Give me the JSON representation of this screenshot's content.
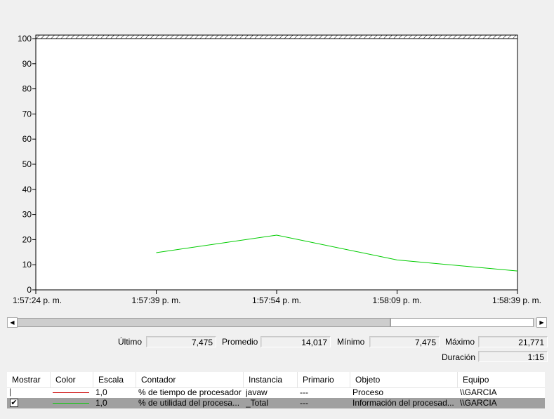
{
  "chart_data": {
    "type": "line",
    "ylim": [
      0,
      100
    ],
    "y_ticks": [
      "0",
      "10",
      "20",
      "30",
      "40",
      "50",
      "60",
      "70",
      "80",
      "90",
      "100"
    ],
    "x_ticks": [
      "1:57:24 p. m.",
      "1:57:39 p. m.",
      "1:57:54 p. m.",
      "1:58:09 p. m.",
      "1:58:39 p. m."
    ],
    "grid": false,
    "series": [
      {
        "color": "#00cc00",
        "points": [
          {
            "x": 1.0,
            "y": 14.8
          },
          {
            "x": 2.0,
            "y": 21.8
          },
          {
            "x": 3.0,
            "y": 11.9
          },
          {
            "x": 4.0,
            "y": 7.5
          }
        ]
      }
    ]
  },
  "stats": {
    "last_label": "Último",
    "last_value": "7,475",
    "avg_label": "Promedio",
    "avg_value": "14,017",
    "min_label": "Mínimo",
    "min_value": "7,475",
    "max_label": "Máximo",
    "max_value": "21,771",
    "duration_label": "Duración",
    "duration_value": "1:15"
  },
  "scrollbar": {
    "left_arrow": "◀",
    "right_arrow": "▶"
  },
  "table": {
    "headers": [
      "Mostrar",
      "Color",
      "Escala",
      "Contador",
      "Instancia",
      "Primario",
      "Objeto",
      "Equipo"
    ],
    "rows": [
      {
        "checked": false,
        "check_mark": "",
        "color": "#cc0000",
        "scale": "1,0",
        "counter": "% de tiempo de procesador",
        "instance": "javaw",
        "parent": "---",
        "object": "Proceso",
        "computer": "\\\\GARCIA"
      },
      {
        "checked": true,
        "check_mark": "✔",
        "color": "#00cc00",
        "scale": "1,0",
        "counter": "% de utilidad del procesa...",
        "instance": "_Total",
        "parent": "---",
        "object": "Información del procesad...",
        "computer": "\\\\GARCIA"
      }
    ]
  }
}
